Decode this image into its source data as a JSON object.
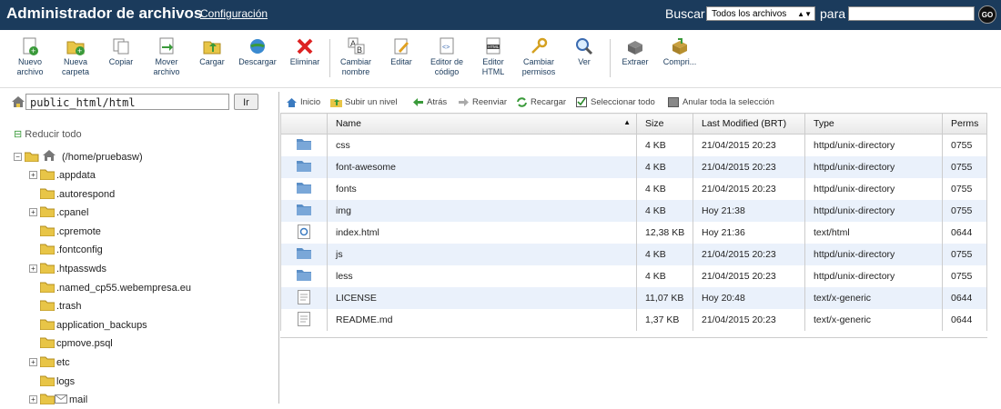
{
  "header": {
    "title": "Administrador de archivos",
    "config_link": "Configuración",
    "search_label": "Buscar",
    "search_scope": "Todos los archivos",
    "for_label": "para",
    "search_value": "",
    "go_label": "GO"
  },
  "toolbar": {
    "buttons": [
      {
        "label": "Nuevo archivo",
        "icon": "new-file-icon"
      },
      {
        "label": "Nueva carpeta",
        "icon": "new-folder-icon"
      },
      {
        "label": "Copiar",
        "icon": "copy-icon"
      },
      {
        "label": "Mover archivo",
        "icon": "move-icon"
      },
      {
        "label": "Cargar",
        "icon": "upload-icon"
      },
      {
        "label": "Descargar",
        "icon": "download-icon"
      },
      {
        "label": "Eliminar",
        "icon": "delete-icon"
      },
      {
        "label": "Cambiar nombre",
        "icon": "rename-icon"
      },
      {
        "label": "Editar",
        "icon": "edit-icon"
      },
      {
        "label": "Editor de código",
        "icon": "code-editor-icon"
      },
      {
        "label": "Editor HTML",
        "icon": "html-editor-icon"
      },
      {
        "label": "Cambiar permisos",
        "icon": "permissions-icon"
      },
      {
        "label": "Ver",
        "icon": "view-icon"
      },
      {
        "label": "Extraer",
        "icon": "extract-icon"
      },
      {
        "label": "Compri...",
        "icon": "compress-icon"
      }
    ]
  },
  "left": {
    "path_value": "public_html/html",
    "go_button": "Ir",
    "collapse_all": "Reducir todo",
    "root_label": "(/home/pruebasw)",
    "tree": [
      {
        "label": ".appdata",
        "expandable": true
      },
      {
        "label": ".autorespond",
        "expandable": false
      },
      {
        "label": ".cpanel",
        "expandable": true
      },
      {
        "label": ".cpremote",
        "expandable": false
      },
      {
        "label": ".fontconfig",
        "expandable": false
      },
      {
        "label": ".htpasswds",
        "expandable": true
      },
      {
        "label": ".named_cp55.webempresa.eu",
        "expandable": false
      },
      {
        "label": ".trash",
        "expandable": false
      },
      {
        "label": "application_backups",
        "expandable": false
      },
      {
        "label": "cpmove.psql",
        "expandable": false
      },
      {
        "label": "etc",
        "expandable": true
      },
      {
        "label": "logs",
        "expandable": false
      },
      {
        "label": "mail",
        "expandable": true
      }
    ]
  },
  "actions": {
    "home": "Inicio",
    "up": "Subir un nivel",
    "back": "Atrás",
    "forward": "Reenviar",
    "reload": "Recargar",
    "select_all": "Seleccionar todo",
    "deselect_all": "Anular toda la selección"
  },
  "table": {
    "headers": {
      "name": "Name",
      "size": "Size",
      "modified": "Last Modified (BRT)",
      "type": "Type",
      "perms": "Perms"
    },
    "rows": [
      {
        "kind": "folder",
        "name": "css",
        "size": "4 KB",
        "modified": "21/04/2015 20:23",
        "type": "httpd/unix-directory",
        "perms": "0755"
      },
      {
        "kind": "folder",
        "name": "font-awesome",
        "size": "4 KB",
        "modified": "21/04/2015 20:23",
        "type": "httpd/unix-directory",
        "perms": "0755"
      },
      {
        "kind": "folder",
        "name": "fonts",
        "size": "4 KB",
        "modified": "21/04/2015 20:23",
        "type": "httpd/unix-directory",
        "perms": "0755"
      },
      {
        "kind": "folder",
        "name": "img",
        "size": "4 KB",
        "modified": "Hoy 21:38",
        "type": "httpd/unix-directory",
        "perms": "0755"
      },
      {
        "kind": "html",
        "name": "index.html",
        "size": "12,38 KB",
        "modified": "Hoy 21:36",
        "type": "text/html",
        "perms": "0644"
      },
      {
        "kind": "folder",
        "name": "js",
        "size": "4 KB",
        "modified": "21/04/2015 20:23",
        "type": "httpd/unix-directory",
        "perms": "0755"
      },
      {
        "kind": "folder",
        "name": "less",
        "size": "4 KB",
        "modified": "21/04/2015 20:23",
        "type": "httpd/unix-directory",
        "perms": "0755"
      },
      {
        "kind": "text",
        "name": "LICENSE",
        "size": "11,07 KB",
        "modified": "Hoy 20:48",
        "type": "text/x-generic",
        "perms": "0644"
      },
      {
        "kind": "text",
        "name": "README.md",
        "size": "1,37 KB",
        "modified": "21/04/2015 20:23",
        "type": "text/x-generic",
        "perms": "0644"
      }
    ]
  },
  "colors": {
    "header_bg": "#1b3b5c",
    "row_alt": "#eaf1fb",
    "folder": "#5b8fc7"
  }
}
